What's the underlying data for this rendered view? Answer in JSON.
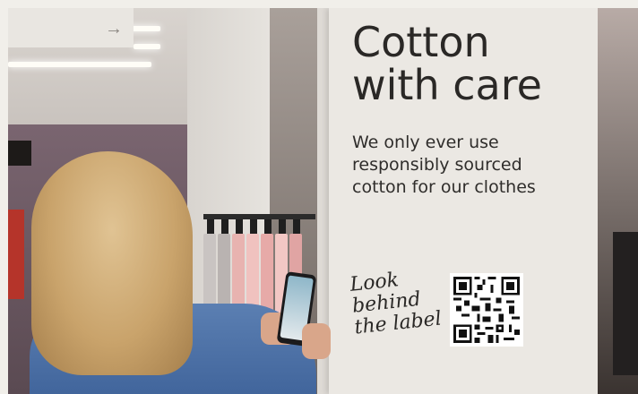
{
  "panel": {
    "headline": "Cotton\nwith care",
    "subtext": "We only ever use\nresponsibly sourced\ncotton for our clothes",
    "logo_text": "Look\nbehind\nthe label"
  },
  "icons": {
    "arrow": "arrow-right-icon",
    "qr": "qr-code-icon"
  },
  "colors": {
    "panel_bg": "#ebe8e3",
    "text": "#2a2826",
    "jacket": "#4a6ea5"
  }
}
